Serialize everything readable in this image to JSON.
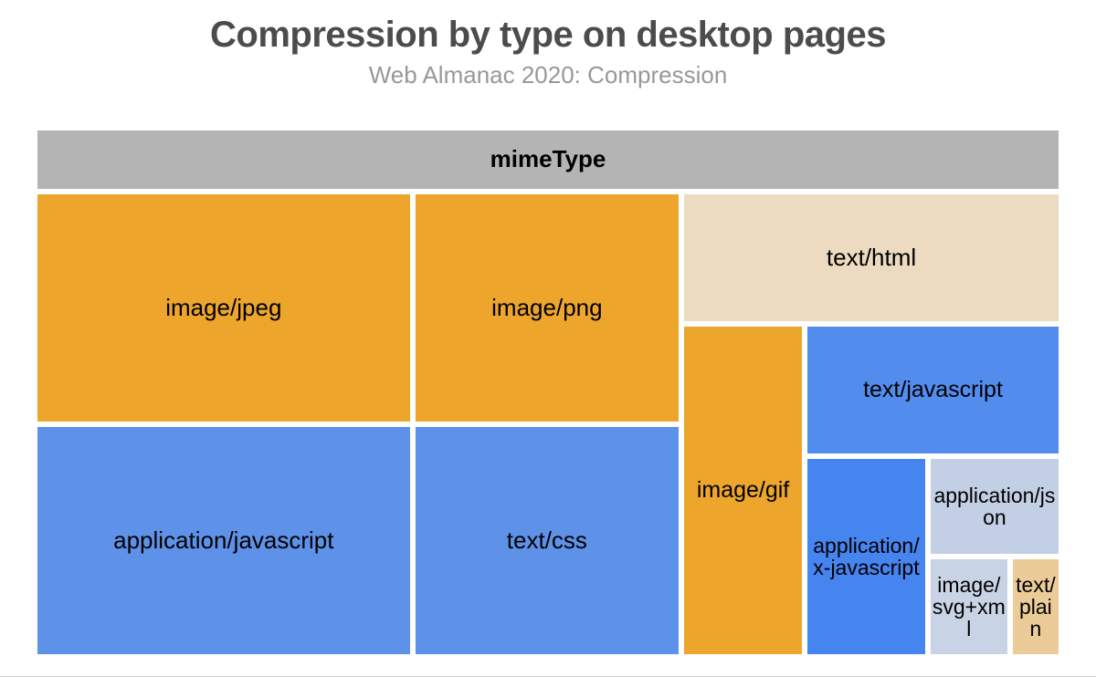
{
  "title": "Compression by type on desktop pages",
  "subtitle": "Web Almanac 2020: Compression",
  "header_label": "mimeType",
  "cells": {
    "image_jpeg": "image/jpeg",
    "image_png": "image/png",
    "text_html": "text/html",
    "application_javascript": "application/javascript",
    "text_css": "text/css",
    "image_gif": "image/gif",
    "text_javascript": "text/javascript",
    "application_x_javascript": "application/x-javascript",
    "application_json": "application/json",
    "image_svg_xml": "image/svg+xml",
    "text_plain": "text/plain"
  },
  "chart_data": {
    "type": "treemap",
    "title": "Compression by type on desktop pages",
    "subtitle": "Web Almanac 2020: Compression",
    "hierarchy_label": "mimeType",
    "note": "Values are approximate relative area proportions estimated from treemap cell sizes; units are percent of total content.",
    "series": [
      {
        "name": "image/jpeg",
        "value": 18.4,
        "color": "#eda62b"
      },
      {
        "name": "image/png",
        "value": 13.1,
        "color": "#eda62b"
      },
      {
        "name": "application/javascript",
        "value": 18.4,
        "color": "#5e92e9"
      },
      {
        "name": "text/css",
        "value": 13.1,
        "color": "#5e92e9"
      },
      {
        "name": "text/html",
        "value": 10.1,
        "color": "#ecdbc0"
      },
      {
        "name": "image/gif",
        "value": 7.9,
        "color": "#eda62b"
      },
      {
        "name": "text/javascript",
        "value": 7.3,
        "color": "#528ced"
      },
      {
        "name": "application/x-javascript",
        "value": 4.2,
        "color": "#4684ef"
      },
      {
        "name": "application/json",
        "value": 3.8,
        "color": "#c3cfe4"
      },
      {
        "name": "image/svg+xml",
        "value": 2.2,
        "color": "#c8d3e6"
      },
      {
        "name": "text/plain",
        "value": 1.5,
        "color": "#ebcc99"
      }
    ]
  }
}
